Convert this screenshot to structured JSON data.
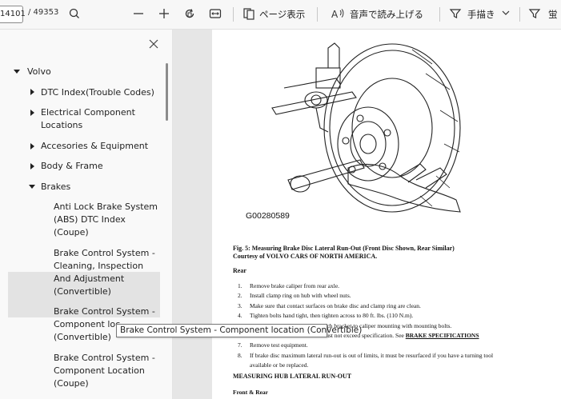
{
  "toolbar": {
    "page_current": "14101",
    "page_total": "/ 49353",
    "page_view_label": "ページ表示",
    "read_aloud_label": "音声で読み上げる",
    "draw_label": "手描き",
    "highlight_label": "蛍"
  },
  "sidebar": {
    "items": [
      {
        "label": "Volvo"
      },
      {
        "label": "DTC Index(Trouble Codes)"
      },
      {
        "label_line1": "Electrical Component",
        "label_line2": "Locations"
      },
      {
        "label": "Accesories & Equipment"
      },
      {
        "label": "Body & Frame"
      },
      {
        "label": "Brakes"
      },
      {
        "line1": "Anti Lock Brake System",
        "line2": "(ABS) DTC Index",
        "line3": "(Coupe)"
      },
      {
        "line1": "Brake Control System -",
        "line2": "Cleaning, Inspection",
        "line3": "And Adjustment",
        "line4": "(Convertible)"
      },
      {
        "line1": "Brake Control System -",
        "line2": "Component loc",
        "line3": "(Convertible)"
      },
      {
        "line1": "Brake Control System -",
        "line2": "Component Location",
        "line3": "(Coupe)"
      }
    ],
    "tooltip": "Brake Control System - Component location (Convertible)"
  },
  "document": {
    "figure_id": "G00280589",
    "caption_line1": "Fig. 5: Measuring Brake Disc Lateral Run-Out (Front Disc Shown, Rear Similar)",
    "caption_line2": "Courtesy of VOLVO CARS OF NORTH AMERICA.",
    "rear_heading": "Rear",
    "steps": [
      {
        "n": "1.",
        "text": "Remove brake caliper from rear axle."
      },
      {
        "n": "2.",
        "text": "Install clamp ring on hub with wheel nuts."
      },
      {
        "n": "3.",
        "text": "Make sure that contact surfaces on brake disc and clamp ring are clean."
      },
      {
        "n": "4.",
        "text": "Tighten bolts hand tight, then tighten across to 80 ft. lbs. (110 N.m)."
      },
      {
        "n": "5.",
        "text": "                               bracket. Attach bracket to caliper mounting with mounting bolts."
      },
      {
        "n": "6.",
        "text": "                               al run-out must not exceed specification. See",
        "link": "BRAKE SPECIFICATIONS"
      },
      {
        "n": "7.",
        "text": "Remove test equipment."
      },
      {
        "n": "8.",
        "text": "If brake disc maximum lateral run-out is out of limits, it must be resurfaced if you have a turning tool"
      },
      {
        "n": "",
        "text": "available or be replaced."
      }
    ],
    "hub_heading": "MEASURING HUB LATERAL RUN-OUT",
    "front_rear": "Front & Rear"
  }
}
